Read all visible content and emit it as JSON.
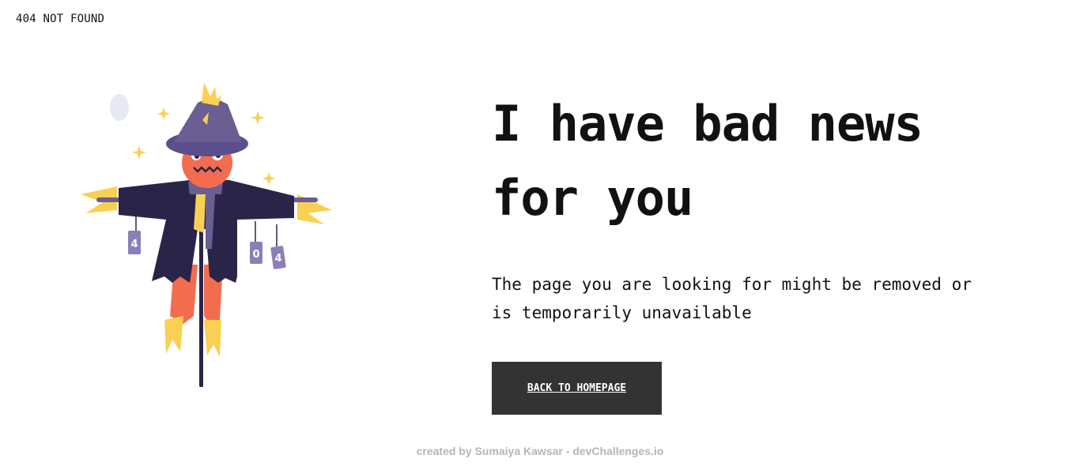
{
  "header": {
    "brand": "404 NOT FOUND"
  },
  "main": {
    "headline_line1": "I have bad news",
    "headline_line2": "for you",
    "message": "The page you are looking for might be removed or is temporarily unavailable",
    "cta_label": "BACK TO HOMEPAGE"
  },
  "illustration": {
    "can_labels": [
      "4",
      "0",
      "4"
    ],
    "colors": {
      "hat": "#5b4e8c",
      "coat": "#2b2449",
      "face": "#f26d50",
      "straw": "#f8d053",
      "moon": "#e6e9f4"
    }
  },
  "footer": {
    "credit": "created by Sumaiya Kawsar - devChallenges.io"
  }
}
